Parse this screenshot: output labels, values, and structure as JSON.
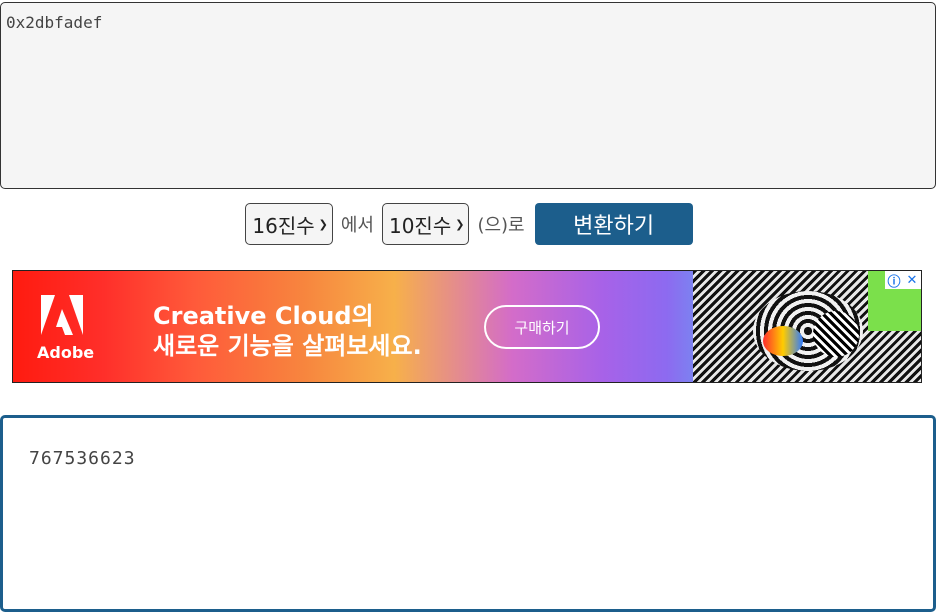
{
  "input": {
    "value": "0x2dbfadef"
  },
  "controls": {
    "from_base": "16진수",
    "connector_from": "에서",
    "to_base": "10진수",
    "connector_to": "(으)로",
    "convert_label": "변환하기"
  },
  "ad": {
    "brand": "Adobe",
    "headline_line1": "Creative Cloud의",
    "headline_line2": "새로운 기능을 살펴보세요.",
    "cta": "구매하기",
    "info_icon": "info-icon",
    "close_icon": "close-icon"
  },
  "output": {
    "value": "767536623"
  },
  "colors": {
    "accent": "#1c5e8c"
  }
}
